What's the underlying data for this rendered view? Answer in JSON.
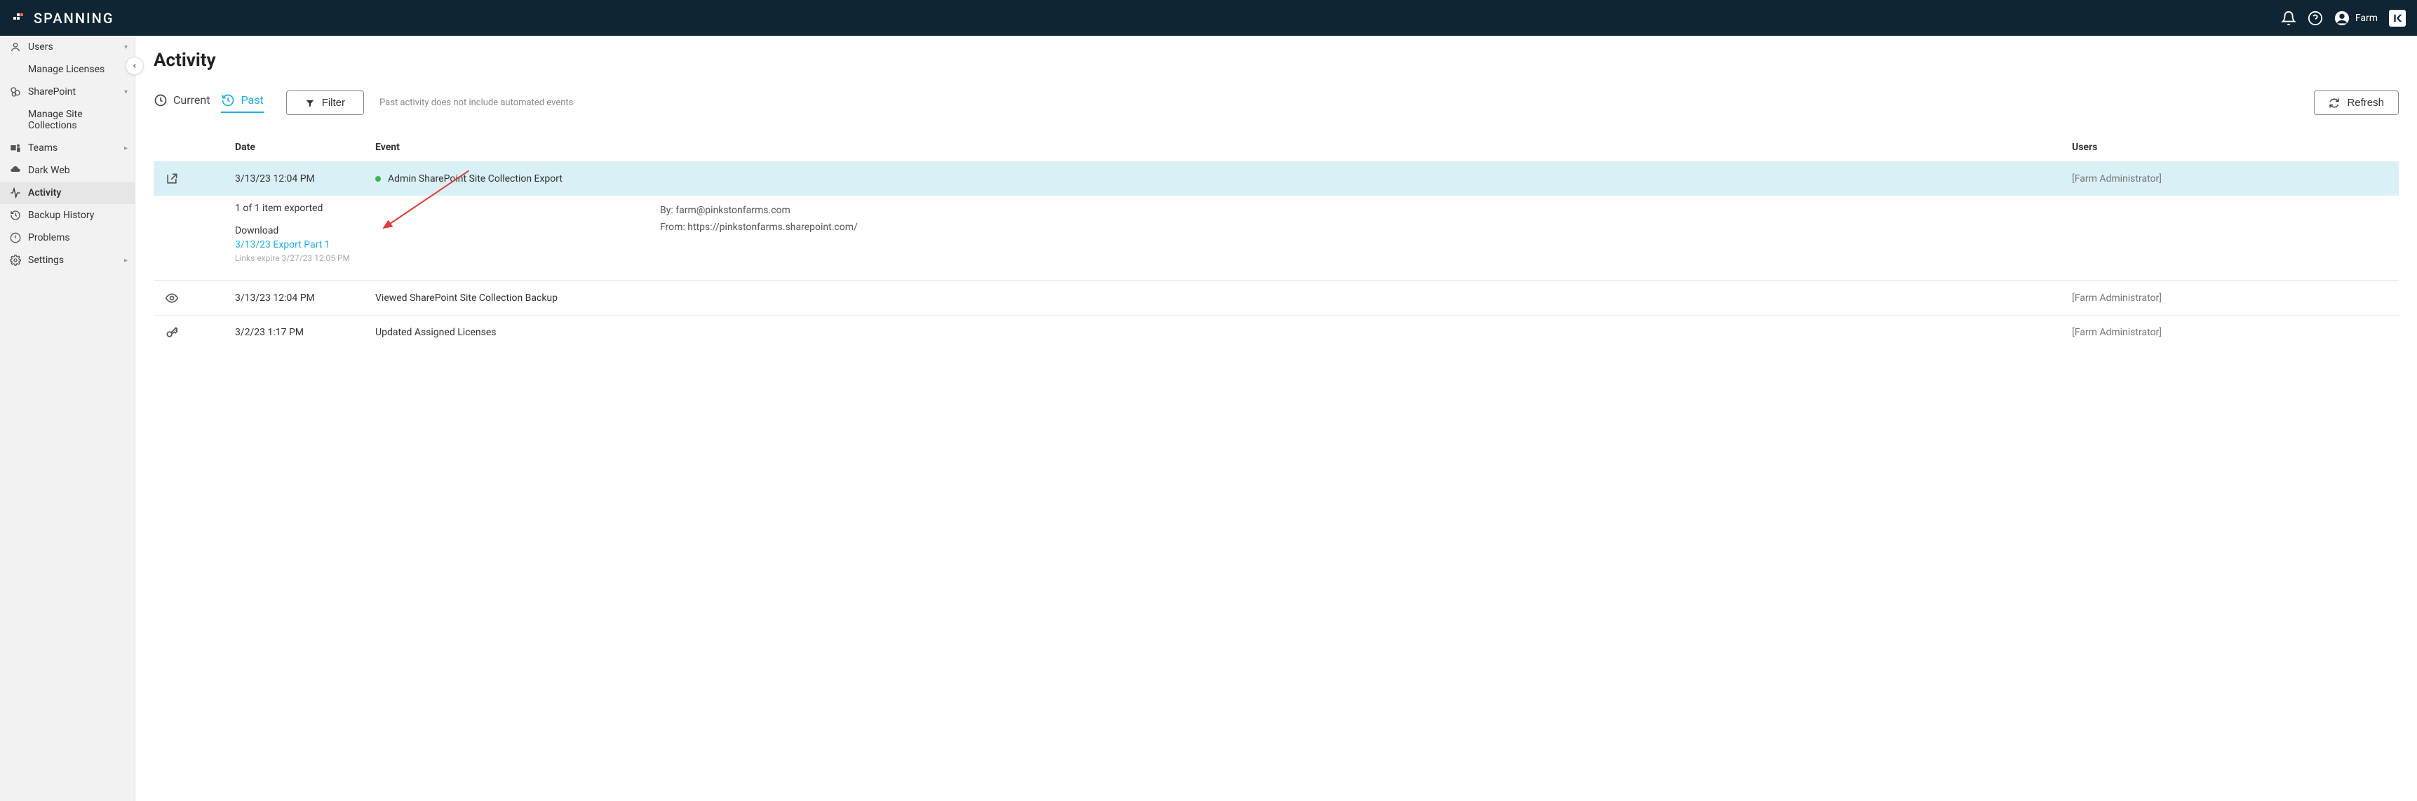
{
  "brand": "SPANNING",
  "user_name": "Farm",
  "sidebar": {
    "users": "Users",
    "manage_licenses": "Manage Licenses",
    "sharepoint": "SharePoint",
    "manage_sites": "Manage Site Collections",
    "teams": "Teams",
    "darkweb": "Dark Web",
    "activity": "Activity",
    "backup_history": "Backup History",
    "problems": "Problems",
    "settings": "Settings"
  },
  "page": {
    "title": "Activity",
    "tab_current": "Current",
    "tab_past": "Past",
    "filter": "Filter",
    "note": "Past activity does not include automated events",
    "refresh": "Refresh"
  },
  "columns": {
    "date": "Date",
    "event": "Event",
    "users": "Users"
  },
  "rows": [
    {
      "date": "3/13/23 12:04 PM",
      "event": "Admin SharePoint Site Collection Export",
      "user": "[Farm Administrator]"
    },
    {
      "date": "3/13/23 12:04 PM",
      "event": "Viewed SharePoint Site Collection Backup",
      "user": "[Farm Administrator]"
    },
    {
      "date": "3/2/23 1:17 PM",
      "event": "Updated Assigned Licenses",
      "user": "[Farm Administrator]"
    }
  ],
  "detail": {
    "count": "1 of 1 item exported",
    "download_label": "Download",
    "download_link": "3/13/23 Export Part 1",
    "expire": "Links expire 3/27/23 12:05 PM",
    "by_label": "By: ",
    "by_value": "farm@pinkstonfarms.com",
    "from_label": "From: ",
    "from_value": "https://pinkstonfarms.sharepoint.com/"
  }
}
